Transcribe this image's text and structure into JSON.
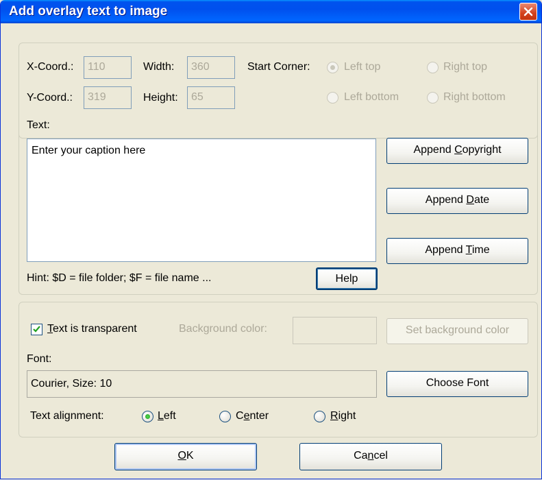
{
  "window": {
    "title": "Add overlay text to image"
  },
  "position": {
    "x_label": "X-Coord.:",
    "x_value": "110",
    "y_label": "Y-Coord.:",
    "y_value": "319",
    "width_label": "Width:",
    "width_value": "360",
    "height_label": "Height:",
    "height_value": "65",
    "corner_label": "Start Corner:",
    "corners": [
      {
        "label": "Left top",
        "selected": true
      },
      {
        "label": "Right top",
        "selected": false
      },
      {
        "label": "Left bottom",
        "selected": false
      },
      {
        "label": "Right bottom",
        "selected": false
      }
    ]
  },
  "text_section": {
    "label": "Text:",
    "value": "Enter your caption here",
    "hint": "Hint: $D = file folder; $F = file name ...",
    "help_button": "Help",
    "append_copyright": {
      "pre": "Append ",
      "key": "C",
      "post": "opyright"
    },
    "append_date": {
      "pre": "Append ",
      "key": "D",
      "post": "ate"
    },
    "append_time": {
      "pre": "Append ",
      "key": "T",
      "post": "ime"
    }
  },
  "style_section": {
    "transparent_checked": true,
    "transparent_label": {
      "key": "T",
      "post": "ext is transparent"
    },
    "bg_color_label": "Background color:",
    "set_bg_button": "Set background color",
    "font_label": "Font:",
    "font_value": "Courier, Size: 10",
    "choose_font_button": "Choose Font",
    "alignment_label": "Text alignment:",
    "alignments": [
      {
        "key": "L",
        "post": "eft",
        "selected": true
      },
      {
        "pre": "C",
        "key": "e",
        "post": "nter",
        "selected": false
      },
      {
        "key": "R",
        "post": "ight",
        "selected": false
      }
    ]
  },
  "footer": {
    "ok": {
      "key": "O",
      "post": "K"
    },
    "cancel": {
      "pre": "Ca",
      "key": "n",
      "post": "cel"
    }
  }
}
